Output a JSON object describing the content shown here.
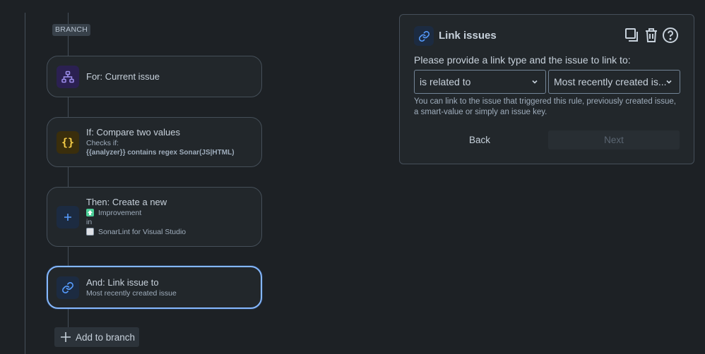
{
  "branch_badge": "BRANCH",
  "steps": [
    {
      "title": "For: Current issue"
    },
    {
      "title": "If: Compare two values",
      "sub": "Checks if:",
      "detail": "{{analyzer}} contains regex Sonar(JS|HTML)"
    },
    {
      "title": "Then: Create a new",
      "issue_type": "Improvement",
      "in": "in",
      "project": "SonarLint for Visual Studio"
    },
    {
      "title": "And: Link issue to",
      "sub": "Most recently created issue"
    }
  ],
  "add_to_branch": "Add to branch",
  "panel": {
    "title": "Link issues",
    "prompt": "Please provide a link type and the issue to link to:",
    "link_type": "is related to",
    "target": "Most recently created is...",
    "helper": "You can link to the issue that triggered this rule, previously created issue, a smart-value or simply an issue key.",
    "back": "Back",
    "next": "Next"
  },
  "icons": {
    "for": "hierarchy-icon",
    "if": "braces-icon",
    "then": "plus-icon",
    "and": "link-icon",
    "duplicate": "duplicate-icon",
    "delete": "trash-icon",
    "help": "help-icon"
  },
  "colors": {
    "accent": "#85b8ff",
    "for_icon": "#9f8fef",
    "if_icon": "#f5cd47",
    "then_icon": "#579dff",
    "improvement": "#4bce97"
  }
}
